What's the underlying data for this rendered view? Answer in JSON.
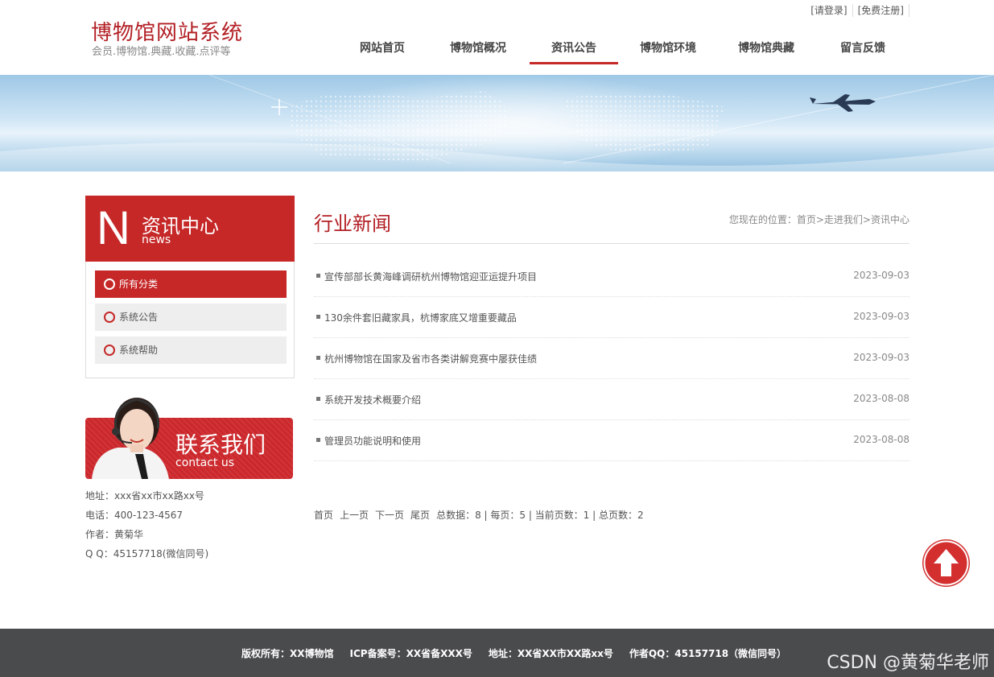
{
  "header": {
    "site_title": "博物馆网站系统",
    "site_subtitle": "会员.博物馆.典藏.收藏.点评等",
    "login_link": "[请登录]",
    "register_link": "[免费注册]"
  },
  "nav": {
    "items": [
      {
        "label": "网站首页"
      },
      {
        "label": "博物馆概况"
      },
      {
        "label": "资讯公告"
      },
      {
        "label": "博物馆环境"
      },
      {
        "label": "博物馆典藏"
      },
      {
        "label": "留言反馈"
      }
    ],
    "active_index": 2
  },
  "sidebar": {
    "header_letter": "N",
    "header_title": "资讯中心",
    "header_en": "news",
    "items": [
      {
        "label": "所有分类",
        "active": true
      },
      {
        "label": "系统公告",
        "active": false
      },
      {
        "label": "系统帮助",
        "active": false
      }
    ],
    "contact_title": "联系我们",
    "contact_en": "contact us",
    "contact_lines": [
      "地址：xxx省xx市xx路xx号",
      "电话：400-123-4567",
      "作者：黄菊华",
      "Q Q：45157718(微信同号)"
    ]
  },
  "main": {
    "title": "行业新闻",
    "breadcrumb": "您现在的位置：首页>走进我们>资讯中心",
    "news": [
      {
        "title": "宣传部部长黄海峰调研杭州博物馆迎亚运提升项目",
        "date": "2023-09-03"
      },
      {
        "title": "130余件套旧藏家具，杭博家底又增重要藏品",
        "date": "2023-09-03"
      },
      {
        "title": "杭州博物馆在国家及省市各类讲解竞赛中屡获佳绩",
        "date": "2023-09-03"
      },
      {
        "title": "系统开发技术概要介绍",
        "date": "2023-08-08"
      },
      {
        "title": "管理员功能说明和使用",
        "date": "2023-08-08"
      }
    ],
    "pager": {
      "first": "首页",
      "prev": "上一页",
      "next": "下一页",
      "last": "尾页",
      "summary": "总数据：8 | 每页：5 | 当前页数：1 | 总页数：2"
    }
  },
  "footer": {
    "copyright": "版权所有：XX博物馆",
    "icp": "ICP备案号：XX省备XXX号",
    "address": "地址：XX省XX市XX路xx号",
    "qq": "作者QQ：45157718（微信同号）",
    "watermark": "CSDN @黄菊华老师"
  },
  "colors": {
    "accent": "#c62828",
    "footer_bg": "#4a4b4d"
  },
  "icons": {
    "back_to_top": "arrow-up-icon",
    "list_bullet": "circle-icon"
  }
}
